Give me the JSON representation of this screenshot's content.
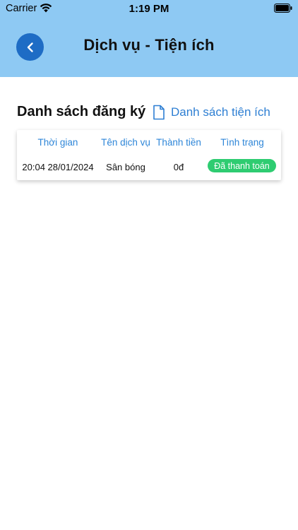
{
  "status_bar": {
    "carrier": "Carrier",
    "time": "1:19 PM"
  },
  "header": {
    "title": "Dịch vụ - Tiện ích"
  },
  "section": {
    "title": "Danh sách đăng ký",
    "utility_link": "Danh sách tiện ích"
  },
  "table": {
    "headers": [
      "Thời gian",
      "Tên dịch vụ",
      "Thành tiền",
      "Tình trạng"
    ],
    "rows": [
      {
        "time": "20:04 28/01/2024",
        "service": "Sân bóng",
        "amount": "0đ",
        "status": "Đã thanh toán"
      }
    ]
  },
  "colors": {
    "header_bg": "#8ec9f3",
    "back_button": "#1e6cc5",
    "accent": "#2e86d8",
    "status_paid": "#2ecc71"
  }
}
